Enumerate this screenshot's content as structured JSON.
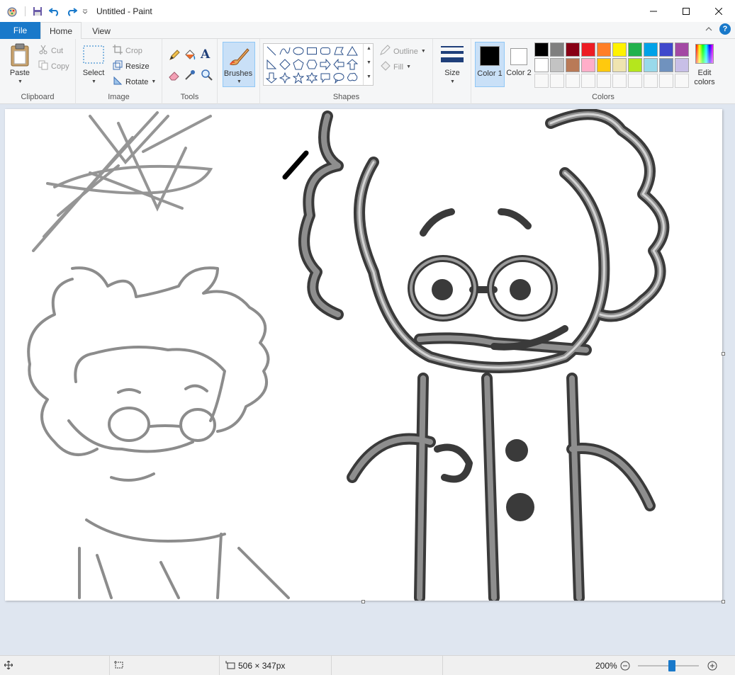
{
  "window": {
    "title": "Untitled - Paint"
  },
  "tabs": {
    "file": "File",
    "home": "Home",
    "view": "View"
  },
  "clipboard": {
    "paste": "Paste",
    "cut": "Cut",
    "copy": "Copy",
    "group": "Clipboard"
  },
  "image": {
    "select": "Select",
    "crop": "Crop",
    "resize": "Resize",
    "rotate": "Rotate",
    "group": "Image"
  },
  "tools": {
    "group": "Tools"
  },
  "brushes": {
    "label": "Brushes"
  },
  "shapes": {
    "outline": "Outline",
    "fill": "Fill",
    "group": "Shapes"
  },
  "size": {
    "label": "Size"
  },
  "colors": {
    "color1": "Color 1",
    "color2": "Color 2",
    "edit": "Edit colors",
    "group": "Colors",
    "color1_value": "#000000",
    "color2_value": "#ffffff",
    "palette_row1": [
      "#000000",
      "#7f7f7f",
      "#880015",
      "#ed1c24",
      "#ff7f27",
      "#fff200",
      "#22b14c",
      "#00a2e8",
      "#3f48cc",
      "#a349a4"
    ],
    "palette_row2": [
      "#ffffff",
      "#c3c3c3",
      "#b97a57",
      "#ffaec9",
      "#ffc90e",
      "#efe4b0",
      "#b5e61d",
      "#99d9ea",
      "#7092be",
      "#c8bfe7"
    ]
  },
  "status": {
    "dimensions": "506 × 347px",
    "zoom": "200%"
  }
}
